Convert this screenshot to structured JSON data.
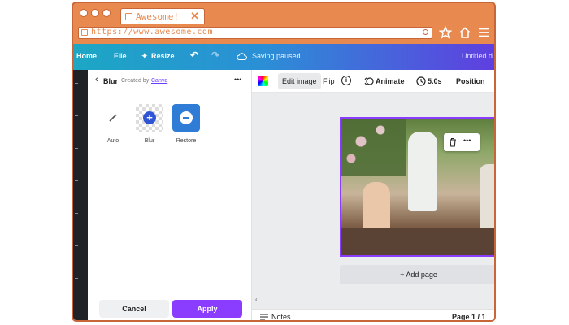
{
  "browser": {
    "tab_title": "Awesome!",
    "tab_close": "✕",
    "url": "https://www.awesome.com",
    "icons": [
      "star-icon",
      "home-icon",
      "menu-icon"
    ]
  },
  "topbar": {
    "home": "Home",
    "file": "File",
    "resize": "Resize",
    "saving": "Saving paused",
    "doc_title": "Untitled d"
  },
  "panel": {
    "back_label": "Blur",
    "created_by": "Created by",
    "creator": "Canva",
    "more": "•••",
    "tools": [
      {
        "label": "Auto"
      },
      {
        "label": "Blur"
      },
      {
        "label": "Restore"
      }
    ],
    "cancel": "Cancel",
    "apply": "Apply"
  },
  "toolbar": {
    "edit_image": "Edit image",
    "flip": "Flip",
    "info": "i",
    "animate": "Animate",
    "duration": "5.0s",
    "position": "Position"
  },
  "canvas": {
    "add_page": "+ Add page"
  },
  "status": {
    "notes": "Notes",
    "page": "Page 1 / 1"
  },
  "colors": {
    "accent": "#8b3dff",
    "browser": "#e8894f"
  }
}
